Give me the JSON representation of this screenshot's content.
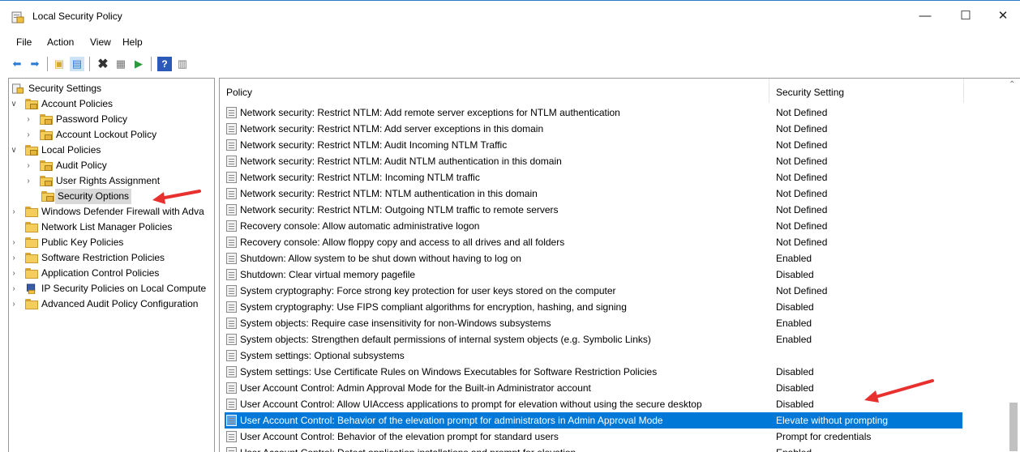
{
  "window": {
    "title": "Local Security Policy",
    "minimize": "—",
    "maximize": "☐",
    "close": "✕"
  },
  "menu": [
    "File",
    "Action",
    "View",
    "Help"
  ],
  "tree": {
    "items": [
      {
        "label": "Security Settings"
      },
      {
        "label": "Account Policies"
      },
      {
        "label": "Password Policy"
      },
      {
        "label": "Account Lockout Policy"
      },
      {
        "label": "Local Policies"
      },
      {
        "label": "Audit Policy"
      },
      {
        "label": "User Rights Assignment"
      },
      {
        "label": "Security Options",
        "selected": true
      },
      {
        "label": "Windows Defender Firewall with Adva"
      },
      {
        "label": "Network List Manager Policies"
      },
      {
        "label": "Public Key Policies"
      },
      {
        "label": "Software Restriction Policies"
      },
      {
        "label": "Application Control Policies"
      },
      {
        "label": "IP Security Policies on Local Compute"
      },
      {
        "label": "Advanced Audit Policy Configuration"
      }
    ]
  },
  "list": {
    "headers": {
      "policy": "Policy",
      "setting": "Security Setting"
    },
    "rows": [
      {
        "policy": "Network security: Restrict NTLM: Add remote server exceptions for NTLM authentication",
        "setting": "Not Defined"
      },
      {
        "policy": "Network security: Restrict NTLM: Add server exceptions in this domain",
        "setting": "Not Defined"
      },
      {
        "policy": "Network security: Restrict NTLM: Audit Incoming NTLM Traffic",
        "setting": "Not Defined"
      },
      {
        "policy": "Network security: Restrict NTLM: Audit NTLM authentication in this domain",
        "setting": "Not Defined"
      },
      {
        "policy": "Network security: Restrict NTLM: Incoming NTLM traffic",
        "setting": "Not Defined"
      },
      {
        "policy": "Network security: Restrict NTLM: NTLM authentication in this domain",
        "setting": "Not Defined"
      },
      {
        "policy": "Network security: Restrict NTLM: Outgoing NTLM traffic to remote servers",
        "setting": "Not Defined"
      },
      {
        "policy": "Recovery console: Allow automatic administrative logon",
        "setting": "Not Defined"
      },
      {
        "policy": "Recovery console: Allow floppy copy and access to all drives and all folders",
        "setting": "Not Defined"
      },
      {
        "policy": "Shutdown: Allow system to be shut down without having to log on",
        "setting": "Enabled"
      },
      {
        "policy": "Shutdown: Clear virtual memory pagefile",
        "setting": "Disabled"
      },
      {
        "policy": "System cryptography: Force strong key protection for user keys stored on the computer",
        "setting": "Not Defined"
      },
      {
        "policy": "System cryptography: Use FIPS compliant algorithms for encryption, hashing, and signing",
        "setting": "Disabled"
      },
      {
        "policy": "System objects: Require case insensitivity for non-Windows subsystems",
        "setting": "Enabled"
      },
      {
        "policy": "System objects: Strengthen default permissions of internal system objects (e.g. Symbolic Links)",
        "setting": "Enabled"
      },
      {
        "policy": "System settings: Optional subsystems",
        "setting": ""
      },
      {
        "policy": "System settings: Use Certificate Rules on Windows Executables for Software Restriction Policies",
        "setting": "Disabled"
      },
      {
        "policy": "User Account Control: Admin Approval Mode for the Built-in Administrator account",
        "setting": "Disabled"
      },
      {
        "policy": "User Account Control: Allow UIAccess applications to prompt for elevation without using the secure desktop",
        "setting": "Disabled"
      },
      {
        "policy": "User Account Control: Behavior of the elevation prompt for administrators in Admin Approval Mode",
        "setting": "Elevate without prompting",
        "selected": true
      },
      {
        "policy": "User Account Control: Behavior of the elevation prompt for standard users",
        "setting": "Prompt for credentials"
      },
      {
        "policy": "User Account Control: Detect application installations and prompt for elevation",
        "setting": "Enabled"
      }
    ]
  },
  "colors": {
    "selection": "#0078d7",
    "annotation_arrow": "#e8312f"
  }
}
